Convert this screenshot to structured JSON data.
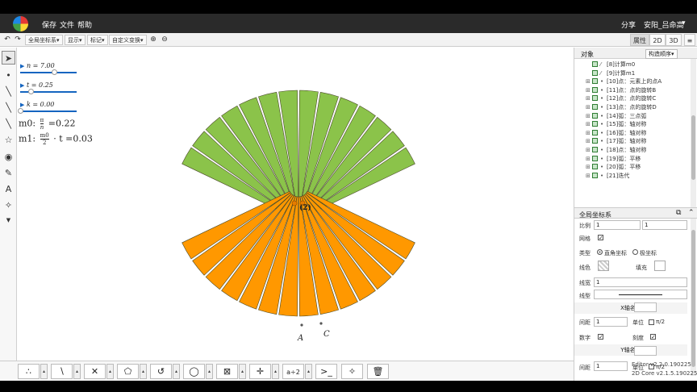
{
  "menubar": {
    "items": [
      "保存",
      "文件",
      "帮助"
    ],
    "share": "分享",
    "user": "安阳_吕命高",
    "user_caret": "▾"
  },
  "toolbar": {
    "undo": "↶",
    "redo": "↷",
    "buttons": [
      "全局坐标系▾",
      "显示▾",
      "标记▾",
      "自定义变换▾"
    ],
    "zoom_in": "⊕",
    "zoom_out": "⊖",
    "view_props": "属性",
    "view_2d": "2D",
    "view_3d": "3D",
    "menu_icon": "≡"
  },
  "sliders": [
    {
      "label": "n = 7.00",
      "value": 7.0,
      "fraction": 0.6
    },
    {
      "label": "t = 0.25",
      "value": 0.25,
      "fraction": 0.18
    },
    {
      "label": "k = 0.00",
      "value": 0.0,
      "fraction": 0.0
    }
  ],
  "formulas": {
    "m0_lhs": "m0:",
    "m0_num": "π",
    "m0_den": "n",
    "m0_rhs": "=0.22",
    "m1_lhs": "m1:",
    "m1_num": "m0",
    "m1_den": "2",
    "m1_rhs": "· t =0.03"
  },
  "canvas": {
    "point_a": "A",
    "point_c": "C",
    "center_label": "(2)",
    "green": "#8bc34a",
    "orange": "#ff9800",
    "fan_count": 14,
    "spread_degrees": 130
  },
  "objects_panel": {
    "tab_objects": "对象",
    "tab_order": "构造顺序▾",
    "items": [
      "[8]计算m0",
      "[9]计算m1",
      "[10]点：元素上的点A",
      "[11]点：点的旋转B",
      "[12]点：点的旋转C",
      "[13]点：点的旋转D",
      "[14]弧：三点弧",
      "[15]弧：轴对称",
      "[16]弧：轴对称",
      "[17]弧：轴对称",
      "[18]点：轴对称",
      "[19]弧：平移",
      "[20]弧：平移",
      "[21]迭代"
    ]
  },
  "props_panel": {
    "title": "全局坐标系",
    "ratio_label": "比例",
    "ratio_x": "1",
    "ratio_y": "1",
    "grid_label": "网格",
    "type_label": "类型",
    "type_rect": "直角坐标",
    "type_polar": "极坐标",
    "linecolor_label": "线色",
    "fill_label": "填充",
    "linewidth_label": "线宽",
    "linewidth_value": "1",
    "linetype_label": "线型",
    "x_axis_title": "X轴名称",
    "y_axis_title": "Y轴名称",
    "spacing_label": "间距",
    "spacing_value": "1",
    "unit_label": "单位",
    "pi2": "π/2",
    "number_label": "数字",
    "tick_label": "刻度"
  },
  "version": {
    "editor": "Editor v2.2.0.190225",
    "core": "2D Core v2.1.5.190225"
  },
  "bottom_tools": [
    "point-tool",
    "segment-tool",
    "intersect-tool",
    "polygon-tool",
    "arc-tool",
    "circle-tool",
    "transform-tool",
    "cross-tool",
    "text-tool",
    "console-tool",
    "magic-tool",
    "trash-tool"
  ],
  "bottom_glyphs": [
    "∴",
    "∖",
    "✕",
    "⬠",
    "↺",
    "◯",
    "⊠",
    "✛",
    "a÷2",
    ">_",
    "✧",
    "🗑"
  ]
}
